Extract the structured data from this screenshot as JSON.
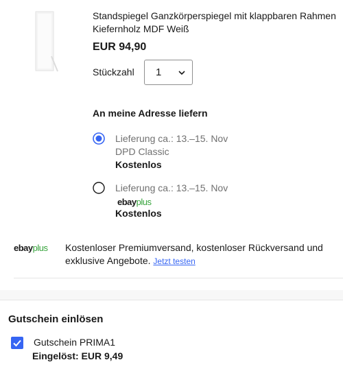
{
  "item": {
    "title": "Standspiegel Ganzkörperspiegel mit klappbaren Rahmen Kiefernholz MDF Weiß",
    "price": "EUR 94,90",
    "quantity_label": "Stückzahl",
    "quantity_value": "1"
  },
  "shipping": {
    "heading": "An meine Adresse liefern",
    "options": [
      {
        "delivery": "Lieferung ca.: 13.–15. Nov",
        "carrier": "DPD Classic",
        "cost": "Kostenlos",
        "selected": true
      },
      {
        "delivery": "Lieferung ca.: 13.–15. Nov",
        "logo_main": "ebay",
        "logo_plus": "plus",
        "cost": "Kostenlos",
        "selected": false
      }
    ]
  },
  "promo": {
    "logo_main": "ebay",
    "logo_plus": "plus",
    "text": "Kostenloser Premiumversand, kostenloser Rückversand und exklusive Angebote.",
    "link": "Jetzt testen"
  },
  "coupon": {
    "heading": "Gutschein einlösen",
    "code_label": "Gutschein PRIMA1",
    "applied": "Eingelöst: EUR 9,49",
    "checked": true
  },
  "colors": {
    "accent": "#3665f3",
    "ebay_plus_green": "#36a33b",
    "text_grey": "#707070"
  },
  "icons": {
    "thumbnail": "standing-mirror-thumbnail",
    "chevron": "chevron-down-icon",
    "check": "check-icon"
  }
}
